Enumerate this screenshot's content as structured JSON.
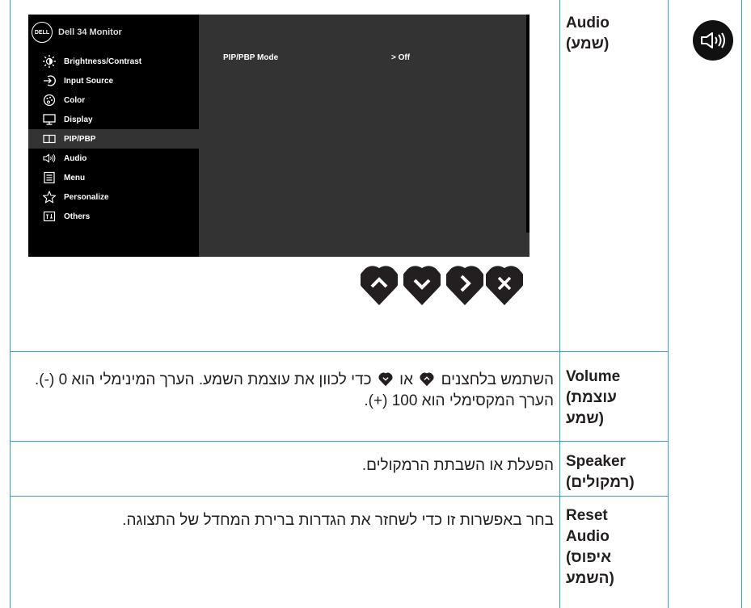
{
  "colors": {
    "border": "#3a9fc6",
    "osd_bg": "#000000",
    "osd_panel": "#333333",
    "button": "#231f20"
  },
  "osd": {
    "brand": "DELL",
    "model": "Dell 34 Monitor",
    "menu": [
      {
        "label": "Brightness/Contrast",
        "icon": "brightness-icon"
      },
      {
        "label": "Input Source",
        "icon": "input-source-icon"
      },
      {
        "label": "Color",
        "icon": "color-palette-icon"
      },
      {
        "label": "Display",
        "icon": "display-icon"
      },
      {
        "label": "PIP/PBP",
        "icon": "pip-icon",
        "active": true
      },
      {
        "label": "Audio",
        "icon": "speaker-icon"
      },
      {
        "label": "Menu",
        "icon": "menu-icon"
      },
      {
        "label": "Personalize",
        "icon": "star-icon"
      },
      {
        "label": "Others",
        "icon": "others-icon"
      }
    ],
    "option_label": "PIP/PBP Mode",
    "option_value": "> Off"
  },
  "controls": [
    "up-button-icon",
    "down-button-icon",
    "right-button-icon",
    "exit-button-icon"
  ],
  "rows": [
    {
      "param": [
        "Audio",
        "(שמע)"
      ],
      "icon": "audio-speaker-icon"
    },
    {
      "param": [
        "Volume",
        "(עוצמת",
        "שמע)"
      ],
      "desc_part1": "השתמש בלחצנים",
      "desc_part2": "או",
      "desc_part3": "כדי לכוון את עוצמת השמע. הערך המינימלי הוא 0 (-). הערך המקסימלי הוא 100 (+)."
    },
    {
      "param": [
        "Speaker",
        "(רמקולים)"
      ],
      "desc": "הפעלת או השבתת הרמקולים."
    },
    {
      "param": [
        "Reset",
        "Audio",
        "(איפוס",
        "השמע)"
      ],
      "desc": "בחר באפשרות זו כדי לשחזר את הגדרות ברירת המחדל של התצוגה."
    }
  ]
}
